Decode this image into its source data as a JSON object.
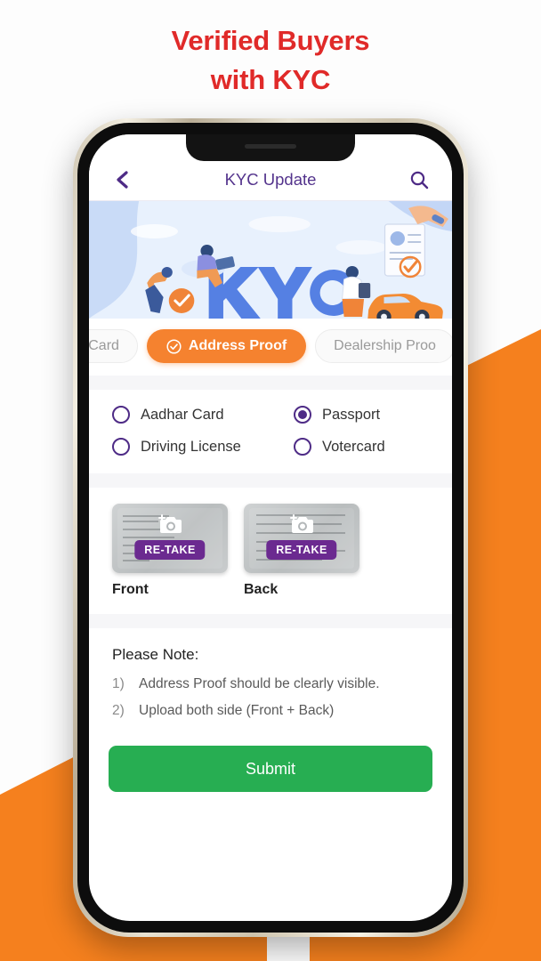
{
  "promo": {
    "headline_line1": "Verified Buyers",
    "headline_line2": "with KYC",
    "headline_color": "#E02A29",
    "background_accent": "#F5801E"
  },
  "app": {
    "header": {
      "back_icon": "chevron-left-icon",
      "title": "KYC Update",
      "title_color": "#53338C",
      "search_icon": "search-icon"
    },
    "hero": {
      "wordmark": "KYC",
      "alt": "People verifying identity documents with car illustration",
      "background_color": "#e4eefb",
      "wordmark_color": "#5580E3"
    },
    "tabs": [
      {
        "label": "an Card",
        "active": false,
        "truncated": true
      },
      {
        "label": "Address Proof",
        "active": true,
        "icon": "check-circle-icon",
        "color": "#F5822F"
      },
      {
        "label": "Dealership Proo",
        "active": false,
        "truncated": true
      }
    ],
    "document_types": {
      "selected": "Passport",
      "options": [
        {
          "label": "Aadhar Card",
          "selected": false
        },
        {
          "label": "Passport",
          "selected": true
        },
        {
          "label": "Driving License",
          "selected": false
        },
        {
          "label": "Votercard",
          "selected": false
        }
      ],
      "accent_color": "#4E2B86"
    },
    "uploads": [
      {
        "label": "Front",
        "action_label": "RE-TAKE",
        "icon": "camera-add-icon",
        "badge_color": "#6B2A90"
      },
      {
        "label": "Back",
        "action_label": "RE-TAKE",
        "icon": "camera-add-icon",
        "badge_color": "#6B2A90"
      }
    ],
    "note": {
      "title": "Please Note:",
      "items": [
        {
          "num": "1)",
          "text": "Address Proof should be clearly visible."
        },
        {
          "num": "2)",
          "text": "Upload both side (Front + Back)"
        }
      ]
    },
    "submit": {
      "label": "Submit",
      "color": "#27AE52"
    }
  }
}
